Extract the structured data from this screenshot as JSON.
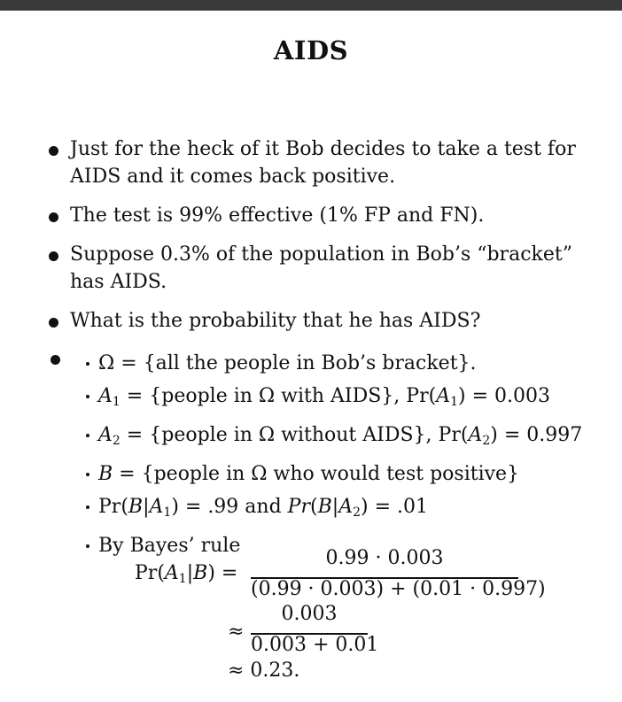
{
  "title": "AIDS",
  "bullets": [
    "Just for the heck of it Bob decides to take a test for AIDS and it comes back positive.",
    "The test is 99% effective (1% FP and FN).",
    "Suppose 0.3% of the population in Bob’s “bracket” has AIDS.",
    "What is the probability that he has AIDS?"
  ],
  "subs": {
    "s1": "Ω = {all the people in Bob’s bracket}.",
    "s2_a": "A",
    "s2_b": " = {people in Ω with AIDS}, Pr(",
    "s2_c": ") = 0.003",
    "s3_b": " = {people in Ω without AIDS}, Pr(",
    "s3_c": ") = 0.997",
    "s4_a": "B",
    "s4_b": " = {people in Ω who would test positive}",
    "s5_a": "Pr(",
    "s5_b": ") = .99 and ",
    "s5_c": "Pr",
    "s5_d": ") = .01",
    "s6": "By Bayes’ rule",
    "one": "1",
    "two": "2"
  },
  "formula": {
    "lhs_pre": "Pr(",
    "lhs_post": ") =",
    "num1": "0.99 · 0.003",
    "den1": "(0.99 · 0.003) + (0.01 · 0.997)",
    "approx": "≈",
    "num2": "0.003",
    "den2": "0.003 + 0.01",
    "result": "≈ 0.23."
  }
}
